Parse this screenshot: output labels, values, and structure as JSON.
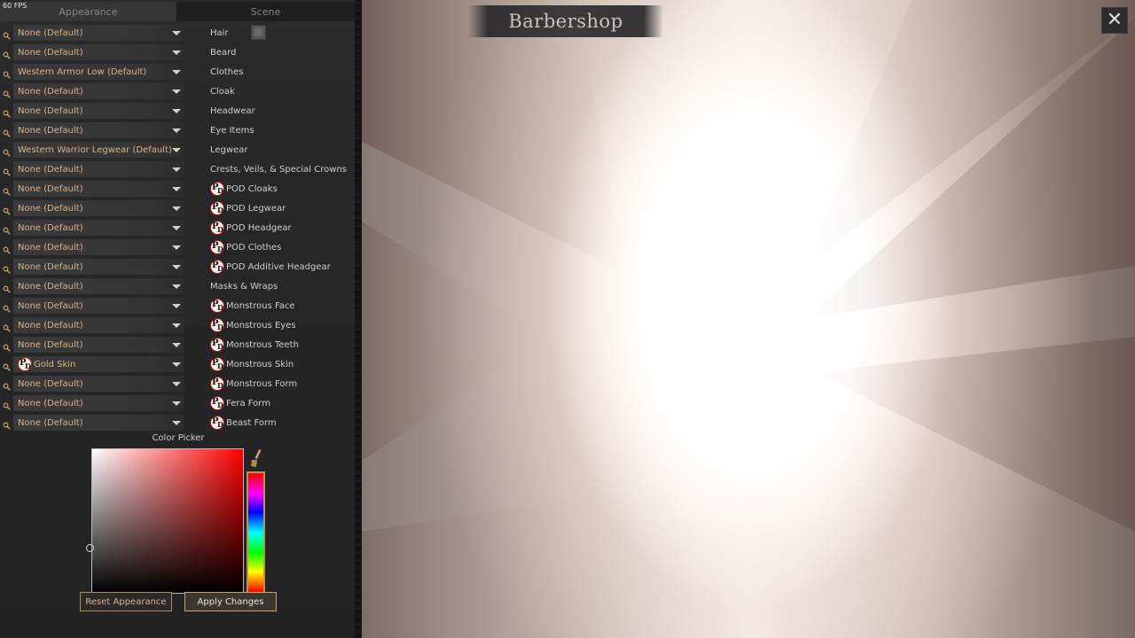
{
  "fps": "60 FPS",
  "tabs": {
    "appearance": "Appearance",
    "scene": "Scene"
  },
  "title": "Barbershop",
  "rows": [
    {
      "value": "None (Default)",
      "label": "Hair",
      "value_icon": false,
      "label_icon": false
    },
    {
      "value": "None (Default)",
      "label": "Beard",
      "value_icon": false,
      "label_icon": false
    },
    {
      "value": "Western Armor Low (Default)",
      "label": "Clothes",
      "value_icon": false,
      "label_icon": false
    },
    {
      "value": "None (Default)",
      "label": "Cloak",
      "value_icon": false,
      "label_icon": false
    },
    {
      "value": "None (Default)",
      "label": "Headwear",
      "value_icon": false,
      "label_icon": false
    },
    {
      "value": "None (Default)",
      "label": "Eye Items",
      "value_icon": false,
      "label_icon": false
    },
    {
      "value": "Western Warrior Legwear (Default)",
      "label": "Legwear",
      "value_icon": false,
      "label_icon": false
    },
    {
      "value": "None (Default)",
      "label": "Crests, Veils, & Special Crowns",
      "value_icon": false,
      "label_icon": false
    },
    {
      "value": "None (Default)",
      "label": "POD Cloaks",
      "value_icon": false,
      "label_icon": true
    },
    {
      "value": "None (Default)",
      "label": "POD Legwear",
      "value_icon": false,
      "label_icon": true
    },
    {
      "value": "None (Default)",
      "label": "POD Headgear",
      "value_icon": false,
      "label_icon": true
    },
    {
      "value": "None (Default)",
      "label": "POD Clothes",
      "value_icon": false,
      "label_icon": true
    },
    {
      "value": "None (Default)",
      "label": "POD Additive Headgear",
      "value_icon": false,
      "label_icon": true
    },
    {
      "value": "None (Default)",
      "label": "Masks & Wraps",
      "value_icon": false,
      "label_icon": false
    },
    {
      "value": "None (Default)",
      "label": "Monstrous Face",
      "value_icon": false,
      "label_icon": true
    },
    {
      "value": "None (Default)",
      "label": "Monstrous Eyes",
      "value_icon": false,
      "label_icon": true
    },
    {
      "value": "None (Default)",
      "label": "Monstrous Teeth",
      "value_icon": false,
      "label_icon": true
    },
    {
      "value": "Gold Skin",
      "label": "Monstrous Skin",
      "value_icon": true,
      "label_icon": true
    },
    {
      "value": "None (Default)",
      "label": "Monstrous Form",
      "value_icon": false,
      "label_icon": true
    },
    {
      "value": "None (Default)",
      "label": "Fera Form",
      "value_icon": false,
      "label_icon": true
    },
    {
      "value": "None (Default)",
      "label": "Beast Form",
      "value_icon": false,
      "label_icon": true
    }
  ],
  "pd_icon": {
    "p": "P",
    "d": "D"
  },
  "color_picker": {
    "title": "Color Picker",
    "selected_hue": "#ff0000"
  },
  "buttons": {
    "reset": "Reset Appearance",
    "apply": "Apply Changes"
  },
  "close": "✕",
  "colors": {
    "accent_gold": "#d8b48a",
    "pd_ring": "#b31b1b"
  },
  "icons": {
    "search": "search-icon",
    "dropdown": "chevron-down-icon",
    "close": "close-icon",
    "brush": "eyedropper-icon",
    "pd": "pod-logo-icon"
  }
}
